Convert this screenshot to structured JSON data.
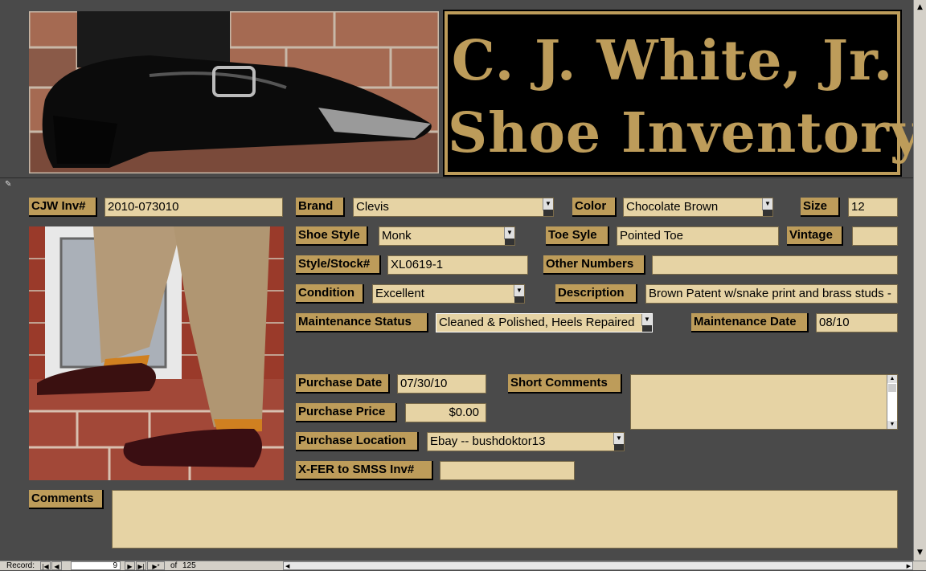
{
  "header": {
    "title_line1": "C. J. White, Jr.",
    "title_line2": "Shoe Inventory"
  },
  "form": {
    "cjw_inv": {
      "label": "CJW Inv#",
      "value": "2010-073010"
    },
    "brand": {
      "label": "Brand",
      "value": "Clevis"
    },
    "color": {
      "label": "Color",
      "value": "Chocolate Brown"
    },
    "size": {
      "label": "Size",
      "value": "12"
    },
    "shoe_style": {
      "label": "Shoe Style",
      "value": "Monk"
    },
    "toe_style": {
      "label": "Toe Syle",
      "value": "Pointed Toe"
    },
    "vintage": {
      "label": "Vintage",
      "value": ""
    },
    "style_stock": {
      "label": "Style/Stock#",
      "value": "XL0619-1"
    },
    "other_numbers": {
      "label": "Other Numbers",
      "value": ""
    },
    "condition": {
      "label": "Condition",
      "value": "Excellent"
    },
    "description": {
      "label": "Description",
      "value": "Brown Patent w/snake print and brass studs -"
    },
    "maintenance_status": {
      "label": "Maintenance Status",
      "value": "Cleaned & Polished, Heels Repaired"
    },
    "maintenance_date": {
      "label": "Maintenance Date",
      "value": "08/10"
    },
    "purchase_date": {
      "label": "Purchase Date",
      "value": "07/30/10"
    },
    "short_comments": {
      "label": "Short Comments",
      "value": ""
    },
    "purchase_price": {
      "label": "Purchase Price",
      "value": "$0.00"
    },
    "purchase_location": {
      "label": "Purchase Location",
      "value": "Ebay -- bushdoktor13"
    },
    "xfer": {
      "label": "X-FER to  SMSS Inv#",
      "value": ""
    },
    "comments": {
      "label": "Comments",
      "value": ""
    }
  },
  "navigation": {
    "record_label": "Record:",
    "current_record": "9",
    "of_label": "of",
    "total_records": "125"
  },
  "colors": {
    "background": "#4a4a4a",
    "label_gold": "#bd9c5a",
    "field_tan": "#e6d3a4",
    "title_black": "#000000"
  }
}
